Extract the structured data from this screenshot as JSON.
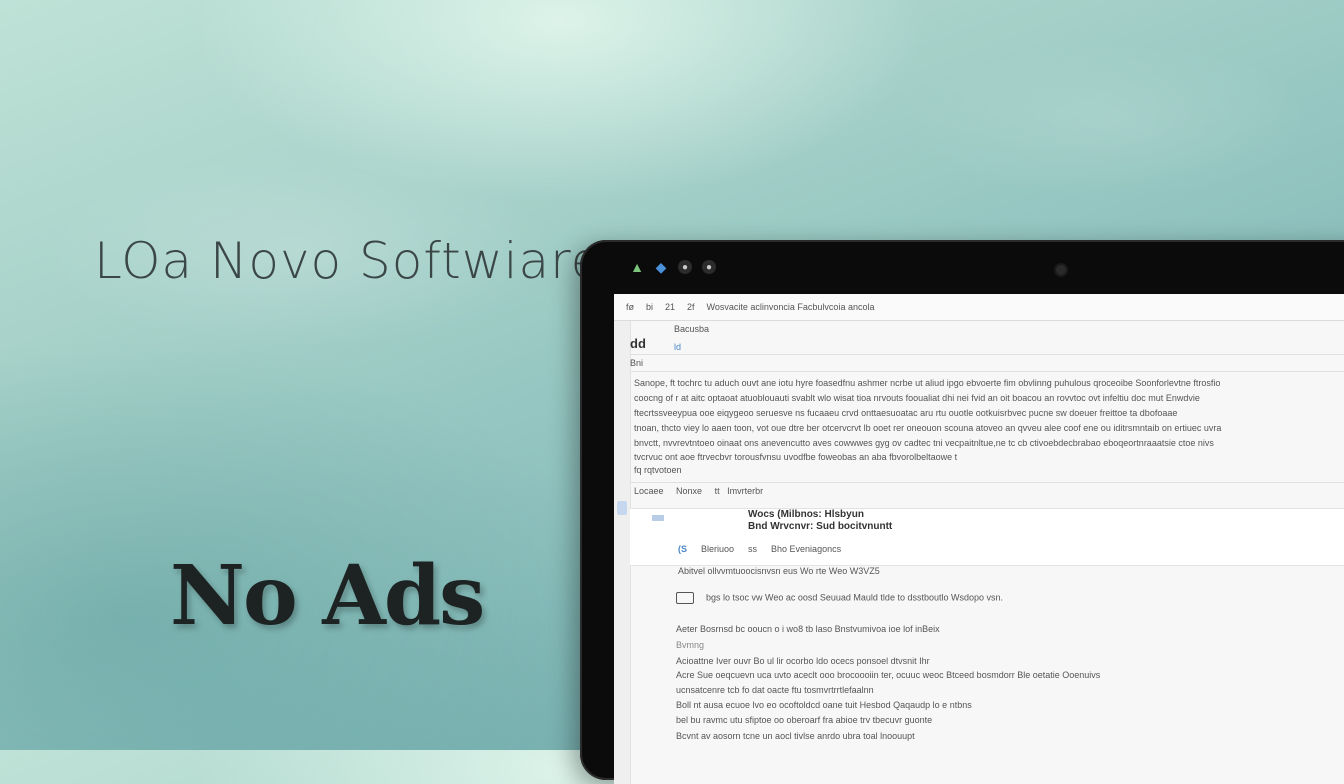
{
  "hero": {
    "headline": "LOa Novo  Softwiare",
    "tagline": "No Ads"
  },
  "device": {
    "topbar_icons": [
      "tree-icon",
      "feather-icon",
      "record-icon",
      "record-icon"
    ]
  },
  "app": {
    "toolbar": {
      "items": [
        "fø",
        "bi",
        "21",
        "2f"
      ],
      "url": "Wosvacite aclinvoncia   Facbulvcoia ancola"
    },
    "header": {
      "top": "Bacusba",
      "logo": "dd",
      "sub": "ld",
      "filter": "Bni"
    },
    "paragraph_lines": [
      "Sanope,   ft tochrc tu aduch ouvt ane iotu hyre foasedfnu ashmer ncrbe ut aliud ipgo ebvoerte fim obvlinng puhulous qroceoibe Soonforlevtne ftrosfio",
      "coocng of  r at aitc optaoat atuoblouauti svablt wlo wisat tioa nrvouts fooualiat dhi nei fvid an oit boacou an rovvtoc ovt infeltiu doc mut Enwdvie",
      "           ftecrtssveeypua ooe eiqygeoo seruesve ns fucaaeu crvd onttaesuoatac aru rtu ouotle ootkuisrbvec pucne sw doeuer freittoe ta dbofoaae",
      "tnoan, thcto viey lo aaen  toon,  vot oue dtre ber otcervcrvt lb  ooet rer oneouon scouna atoveo an qvveu alee coof ene ou iditrsmntaib on  ertiuec uvra",
      "bnvctt,  nvvrevtntoeo oinaat  ons  anevencutto aves cowwwes gyg ov cadtec tni vecpaitnltue,ne  tc cb ctivoebdecbrabao  eboqeortnraaatsie ctoe nivs",
      "          tvcrvuc ont aoe ftrvecbvr                       torousfvnsu uvodfbe                                                   foweobas an aba  fbvorolbeltaowe t",
      "              fq  rqtvotoen"
    ],
    "list_header": [
      "Locaee",
      "Nonxe",
      "tt",
      "Imvrterbr"
    ],
    "card": {
      "title1": "Wocs (Milbnos: Hlsbyun",
      "title2": "Bnd Wrvcnvr: Sud bocitvnuntt",
      "meta": [
        "(S",
        "Bleriuoo",
        "ss",
        "Bho Eveniagoncs"
      ]
    },
    "body_lines": [
      "Abitvel ollvvmtuoocisnvsn eus Wo   rte Weo W3VZ5",
      "bgs lo  tsoc vw Weo ac oosd  Seuuad Mauld tlde  to dsstboutlo  Wsdopo  vsn.",
      "Aeter   Bosrnsd bc ooucn o  i wo8   tb laso   Bnstvumivoa ioe lof  inBeix",
      "Bvmng",
      "        Acioattne Iver  ouvr  Bo ul  lir ocorbo  ldo  ocecs ponsoel  dtvsnit  Ihr",
      "Acre   Sue  oeqcuevn uca uvto aceclt ooo  brocoooiin   ter,  ocuuc  weoc Btceed  bosmdorr  Ble oetatie  Ooenuivs",
      "             ucnsatcenre  tcb  fo dat  oacte  ftu  tosmvrtrrtlefaalnn",
      "Boll  nt  ausa  ecuoe lvo eo  ocoftoldcd  oane  tuit  Hesbod  Qaqaudp  lo  e  ntbns",
      "              bel  bu  ravmc  utu  sfiptoe  oo  oberoarf  fra  abioe  trv  tbecuvr  guonte",
      "Bcvnt  av  aosorn  tcne  un  aocl  tivlse  anrdo  ubra  toal  lnoouupt"
    ]
  }
}
